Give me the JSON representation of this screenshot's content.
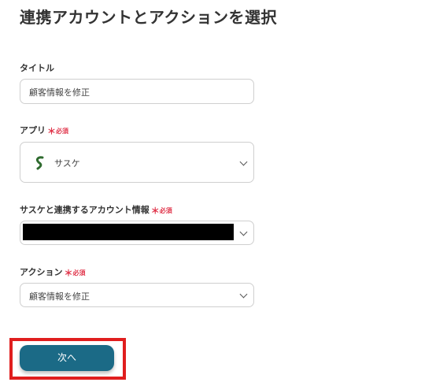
{
  "page": {
    "title": "連携アカウントとアクションを選択"
  },
  "fields": {
    "title": {
      "label": "タイトル",
      "value": "顧客情報を修正"
    },
    "app": {
      "label": "アプリ",
      "required": "必須",
      "value": "サスケ"
    },
    "account": {
      "label": "サスケと連携するアカウント情報",
      "required": "必須"
    },
    "action": {
      "label": "アクション",
      "required": "必須",
      "value": "顧客情報を修正"
    }
  },
  "buttons": {
    "next_label": "次へ"
  },
  "colors": {
    "primary": "#1b6a86",
    "required": "#e0344a",
    "highlight": "#e01e1e"
  },
  "icons": {
    "app": "sasuke-logo-icon",
    "dropdown": "chevron-down-icon"
  }
}
